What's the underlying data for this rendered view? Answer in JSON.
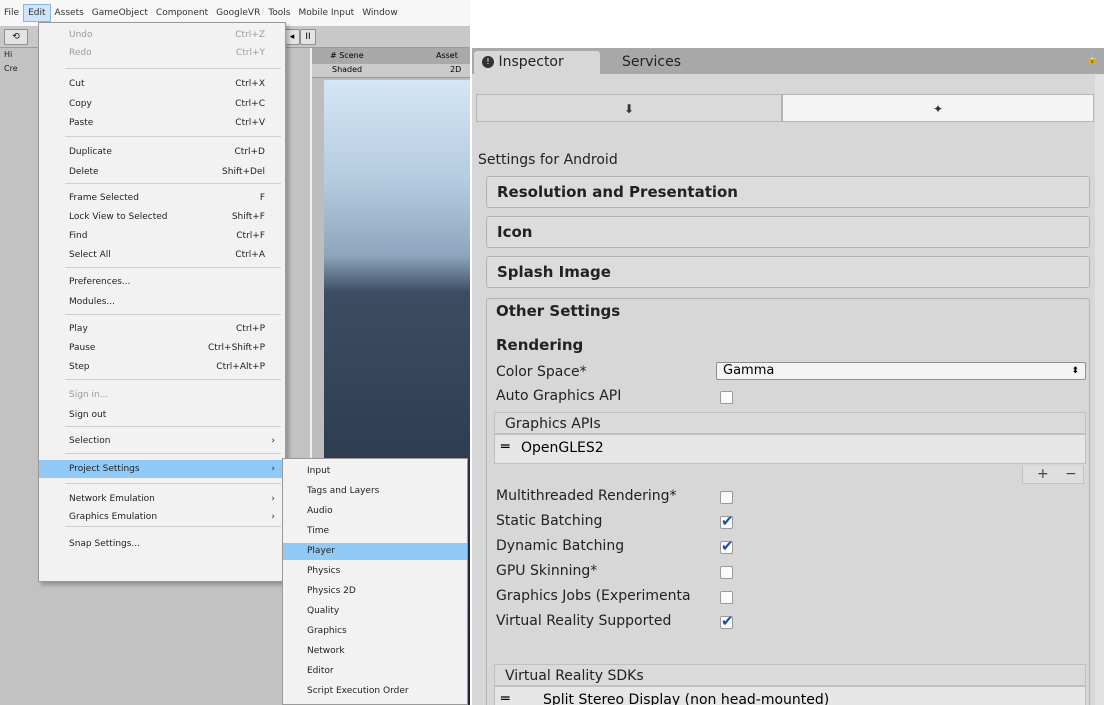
{
  "menubar": {
    "items": [
      "File",
      "Edit",
      "Assets",
      "GameObject",
      "Component",
      "GoogleVR",
      "Tools",
      "Mobile Input",
      "Window"
    ]
  },
  "toolbar": {
    "buttons": [
      "⟲",
      "◂",
      "II"
    ]
  },
  "hierarchy": {
    "tab": "Hi",
    "create": "Cre"
  },
  "scene": {
    "tab1": "# Scene",
    "tab2": "Asset",
    "shading": "Shaded",
    "mode": "2D"
  },
  "edit_menu": {
    "items": [
      {
        "label": "Undo",
        "shortcut": "Ctrl+Z",
        "disabled": true
      },
      {
        "label": "Redo",
        "shortcut": "Ctrl+Y",
        "disabled": true
      },
      {
        "label": "Cut",
        "shortcut": "Ctrl+X"
      },
      {
        "label": "Copy",
        "shortcut": "Ctrl+C"
      },
      {
        "label": "Paste",
        "shortcut": "Ctrl+V"
      },
      {
        "label": "Duplicate",
        "shortcut": "Ctrl+D"
      },
      {
        "label": "Delete",
        "shortcut": "Shift+Del"
      },
      {
        "label": "Frame Selected",
        "shortcut": "F"
      },
      {
        "label": "Lock View to Selected",
        "shortcut": "Shift+F"
      },
      {
        "label": "Find",
        "shortcut": "Ctrl+F"
      },
      {
        "label": "Select All",
        "shortcut": "Ctrl+A"
      },
      {
        "label": "Preferences..."
      },
      {
        "label": "Modules..."
      },
      {
        "label": "Play",
        "shortcut": "Ctrl+P"
      },
      {
        "label": "Pause",
        "shortcut": "Ctrl+Shift+P"
      },
      {
        "label": "Step",
        "shortcut": "Ctrl+Alt+P"
      },
      {
        "label": "Sign in...",
        "disabled": true
      },
      {
        "label": "Sign out"
      },
      {
        "label": "Selection",
        "arrow": "›"
      },
      {
        "label": "Project Settings",
        "arrow": "›",
        "highlighted": true
      },
      {
        "label": "Network Emulation",
        "arrow": "›"
      },
      {
        "label": "Graphics Emulation",
        "arrow": "›"
      },
      {
        "label": "Snap Settings..."
      }
    ]
  },
  "project_settings_submenu": {
    "items": [
      "Input",
      "Tags and Layers",
      "Audio",
      "Time",
      "Player",
      "Physics",
      "Physics 2D",
      "Quality",
      "Graphics",
      "Network",
      "Editor",
      "Script Execution Order"
    ],
    "highlighted": "Player"
  },
  "inspector": {
    "tabs": {
      "inspector": "Inspector",
      "services": "Services"
    },
    "settings_for": "Settings for Android",
    "sections": [
      "Resolution and Presentation",
      "Icon",
      "Splash Image"
    ],
    "other": {
      "title": "Other Settings",
      "rendering": "Rendering",
      "color_space_label": "Color Space*",
      "color_space_value": "Gamma",
      "auto_graphics_label": "Auto Graphics API",
      "auto_graphics_checked": false,
      "graphics_apis_label": "Graphics APIs",
      "graphics_api_item": "OpenGLES2",
      "plus": "+",
      "minus": "−",
      "options": [
        {
          "label": "Multithreaded Rendering*",
          "checked": false
        },
        {
          "label": "Static Batching",
          "checked": true
        },
        {
          "label": "Dynamic Batching",
          "checked": true
        },
        {
          "label": "GPU Skinning*",
          "checked": false
        },
        {
          "label": "Graphics Jobs (Experimenta",
          "checked": false
        },
        {
          "label": "Virtual Reality Supported",
          "checked": true
        }
      ],
      "vr_sdks_label": "Virtual Reality SDKs",
      "vr_sdk_item": "Split Stereo Display (non head-mounted)"
    }
  },
  "colors": {
    "highlight": "#91c9f7",
    "check": "#1a4fa8",
    "panel": "#d7d7d7"
  }
}
